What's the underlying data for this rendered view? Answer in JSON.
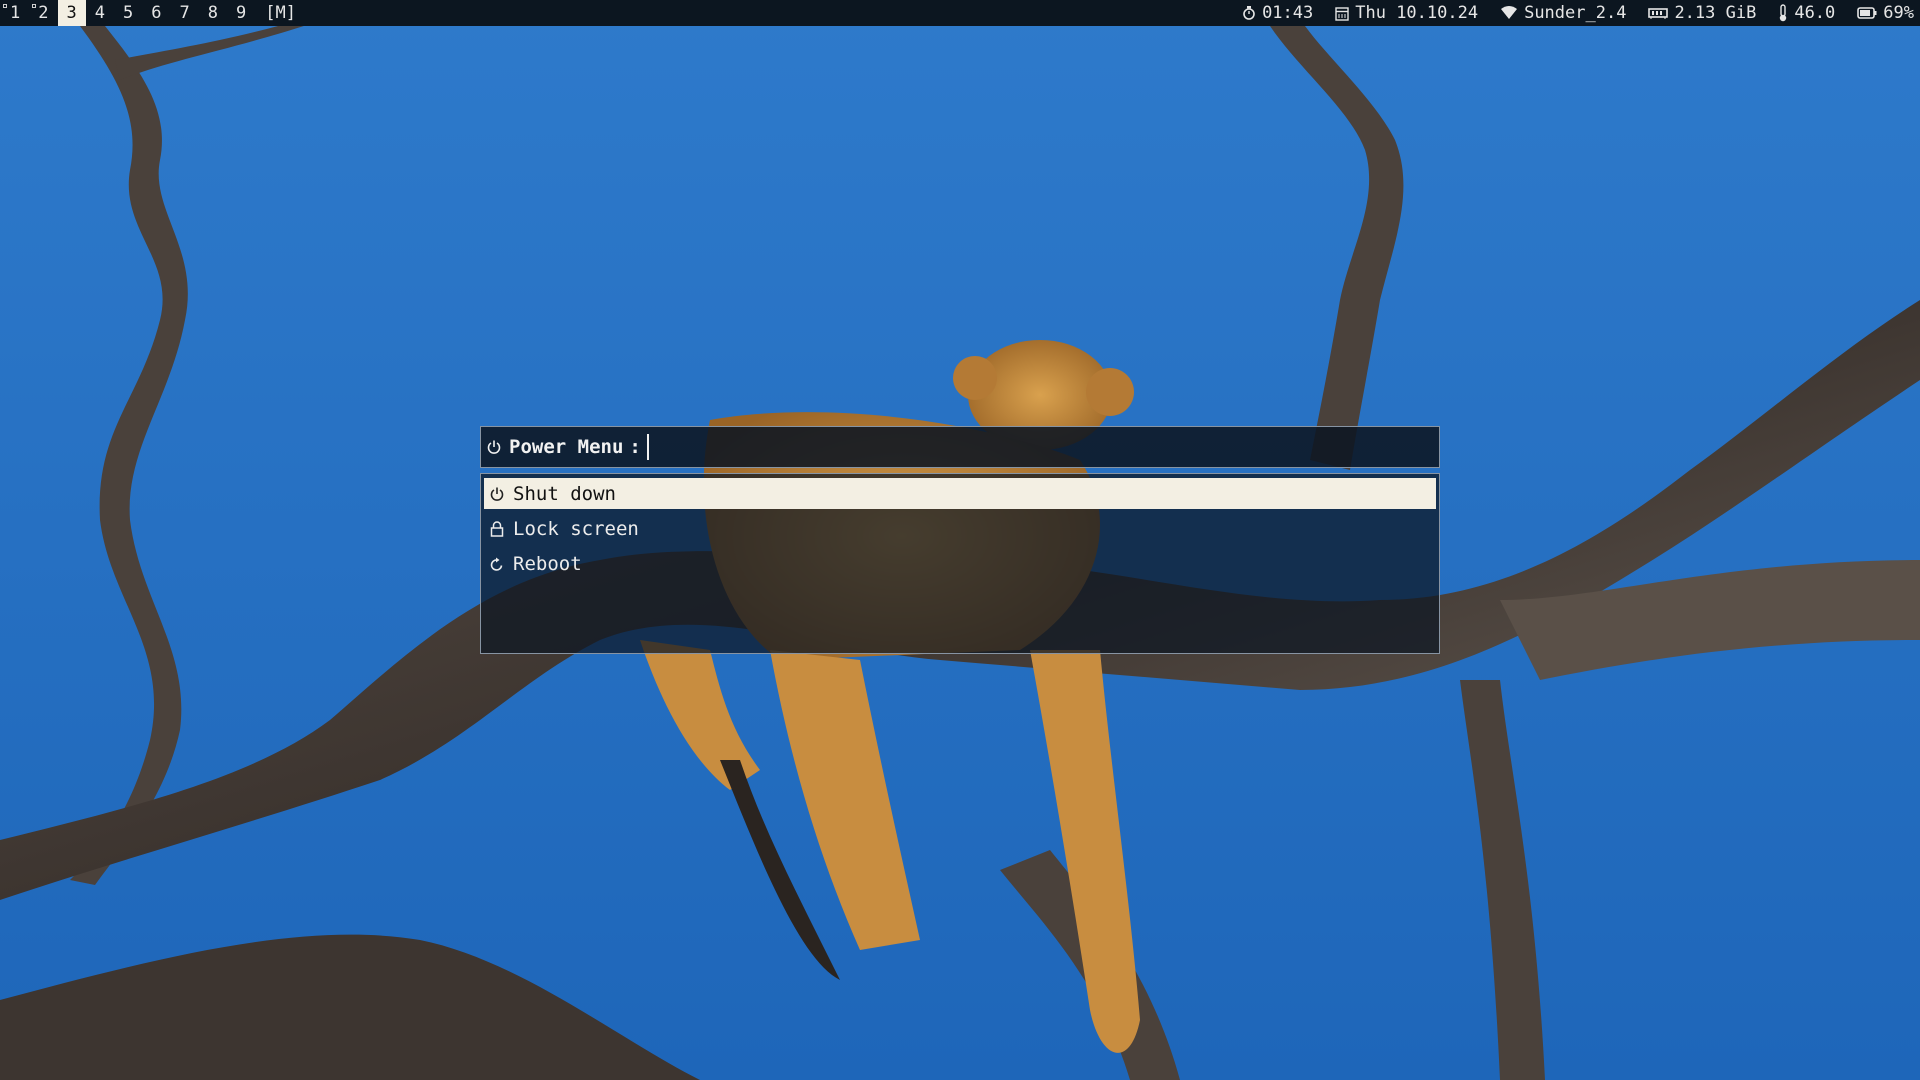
{
  "topbar": {
    "workspaces": [
      "1",
      "2",
      "3",
      "4",
      "5",
      "6",
      "7",
      "8",
      "9"
    ],
    "active_workspace": "3",
    "layout_indicator": "[M]",
    "status": {
      "time": "01:43",
      "date": "Thu 10.10.24",
      "wifi": "Sunder_2.4",
      "memory": "2.13 GiB",
      "temperature": "46.0",
      "battery": "69%"
    }
  },
  "power_menu": {
    "prompt_label": "Power Menu",
    "prompt_separator": ":",
    "input_value": "",
    "entries": [
      {
        "label": "Shut down",
        "icon": "power-icon"
      },
      {
        "label": "Lock screen",
        "icon": "lock-icon"
      },
      {
        "label": "Reboot",
        "icon": "reboot-icon"
      }
    ],
    "selected_index": 0
  },
  "colors": {
    "bar_background": "#0c1620",
    "selected_background": "#f3efe3",
    "sky": "#2d79c7"
  }
}
